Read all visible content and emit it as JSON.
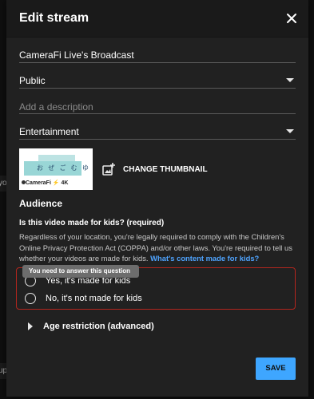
{
  "background": {
    "left_fragment": "yo",
    "bottom_fragment": "up"
  },
  "dialog": {
    "title": "Edit stream",
    "close_icon": "close-icon"
  },
  "form": {
    "title_value": "CameraFi Live's Broadcast",
    "privacy_value": "Public",
    "description_placeholder": "Add a description",
    "category_value": "Entertainment"
  },
  "thumbnail": {
    "glyphs": "お ぜ ご む ゆ",
    "brand": "CameraFi ⚡ 4K",
    "change_label": "CHANGE THUMBNAIL",
    "icon": "add-photo-icon"
  },
  "audience": {
    "section_title": "Audience",
    "question": "Is this video made for kids? (required)",
    "description": "Regardless of your location, you're legally required to comply with the Children's Online Privacy Protection Act (COPPA) and/or other laws. You're required to tell us whether your videos are made for kids.",
    "link_text": "What's content made for kids?",
    "tooltip": "You need to answer this question",
    "option_yes": "Yes, it's made for kids",
    "option_no": "No, it's not made for kids",
    "error_color": "#b3261e"
  },
  "age_restriction": {
    "label": "Age restriction (advanced)"
  },
  "actions": {
    "save_label": "SAVE",
    "accent_color": "#3ea6ff"
  }
}
